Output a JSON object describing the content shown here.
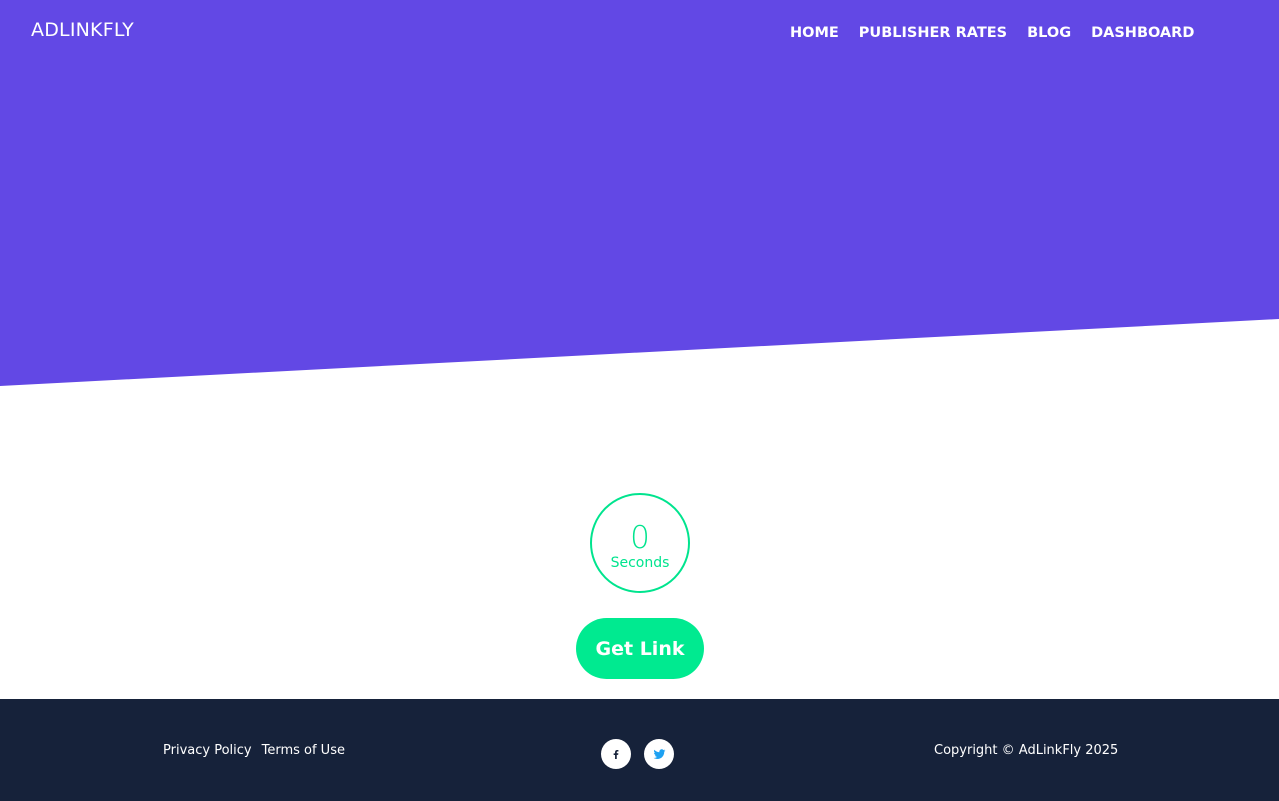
{
  "header": {
    "brand": "ADLINKFLY",
    "nav": [
      {
        "label": "HOME"
      },
      {
        "label": "PUBLISHER RATES"
      },
      {
        "label": "BLOG"
      },
      {
        "label": "DASHBOARD"
      }
    ]
  },
  "timer": {
    "value": "0",
    "unit": "Seconds"
  },
  "cta": {
    "label": "Get Link"
  },
  "footer": {
    "links": [
      {
        "label": "Privacy Policy"
      },
      {
        "label": "Terms of Use"
      }
    ],
    "social": [
      {
        "icon": "facebook-icon"
      },
      {
        "icon": "twitter-icon"
      }
    ],
    "copyright": "Copyright © AdLinkFly 2025"
  },
  "colors": {
    "hero": "#6248e5",
    "accent": "#00ea90",
    "footer": "#16223a",
    "twitter": "#1da1f2",
    "facebook": "#16223a"
  }
}
